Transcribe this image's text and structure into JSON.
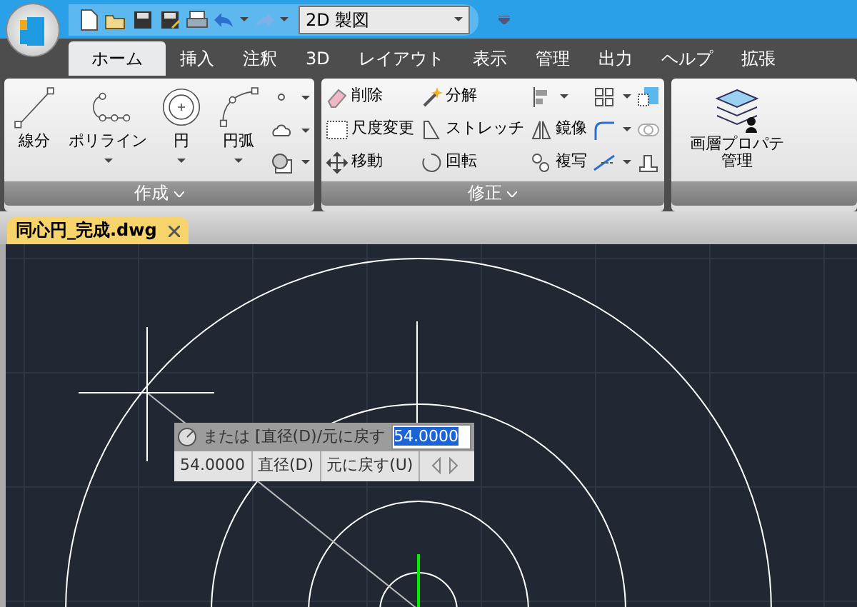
{
  "title_bar": {
    "workspace": "2D 製図"
  },
  "ribbon_tabs": [
    {
      "label": "ホーム",
      "selected": true
    },
    {
      "label": "挿入",
      "selected": false
    },
    {
      "label": "注釈",
      "selected": false
    },
    {
      "label": "3D",
      "selected": false
    },
    {
      "label": "レイアウト",
      "selected": false
    },
    {
      "label": "表示",
      "selected": false
    },
    {
      "label": "管理",
      "selected": false
    },
    {
      "label": "出力",
      "selected": false
    },
    {
      "label": "ヘルプ",
      "selected": false
    },
    {
      "label": "拡張",
      "selected": false
    }
  ],
  "create_panel": {
    "title": "作成",
    "large_tools": [
      {
        "label": "線分",
        "dropdown": false
      },
      {
        "label": "ポリライン",
        "dropdown": true
      },
      {
        "label": "円",
        "dropdown": true
      },
      {
        "label": "円弧",
        "dropdown": true
      }
    ],
    "small_tools": [
      {
        "dropdown": true
      },
      {
        "dropdown": true
      },
      {
        "dropdown": true
      }
    ]
  },
  "modify_panel": {
    "title": "修正",
    "columns": [
      [
        {
          "label": "削除",
          "dropdown": false
        },
        {
          "label": "尺度変更",
          "dropdown": false
        },
        {
          "label": "移動",
          "dropdown": false
        }
      ],
      [
        {
          "label": "分解",
          "dropdown": false
        },
        {
          "label": "ストレッチ",
          "dropdown": false
        },
        {
          "label": "回転",
          "dropdown": false
        }
      ],
      [
        {
          "dropdown": true
        },
        {
          "label": "鏡像",
          "dropdown": false
        },
        {
          "label": "複写",
          "dropdown": false
        }
      ],
      [
        {
          "dropdown": true
        },
        {
          "dropdown": true
        },
        {
          "dropdown": true
        }
      ],
      [
        {
          "dropdown": false
        },
        {
          "dropdown": false
        },
        {
          "dropdown": false
        }
      ]
    ]
  },
  "layer_panel": {
    "label_lines": [
      "画層プロパテ",
      "管理"
    ]
  },
  "document_tabs": [
    {
      "label": "同心円_完成.dwg",
      "selected": true
    }
  ],
  "dynamic_input": {
    "prompt": "または [直径(D)/元に戻す",
    "value": "54.0000",
    "options": [
      "54.0000",
      "直径(D)",
      "元に戻す(U)"
    ]
  }
}
